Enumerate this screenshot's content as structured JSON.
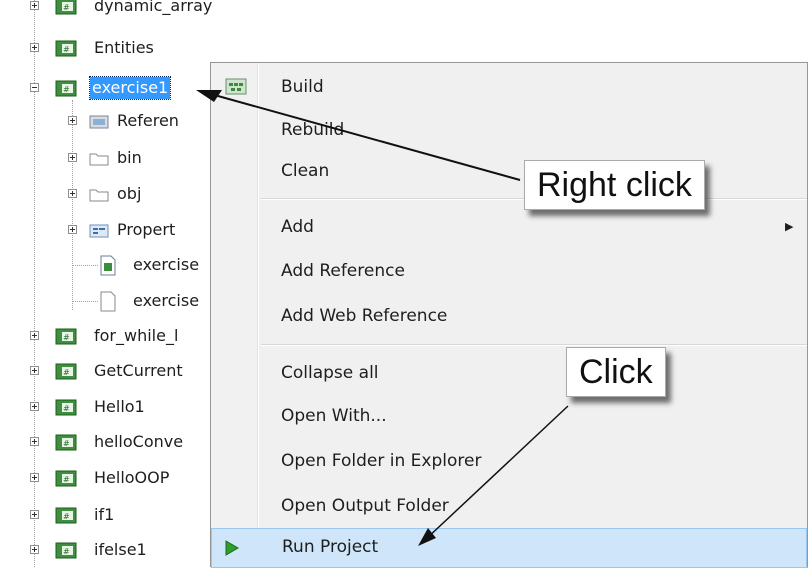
{
  "tree": {
    "items": [
      {
        "label": "dynamic_array",
        "icon": "csharp-project-icon",
        "expander": "plus"
      },
      {
        "label": "Entities",
        "icon": "csharp-project-icon",
        "expander": "plus"
      },
      {
        "label": "exercise1",
        "icon": "csharp-project-icon",
        "expander": "minus",
        "selected": true
      },
      {
        "label": "Referen",
        "icon": "references-icon",
        "expander": "plus"
      },
      {
        "label": "bin",
        "icon": "folder-icon",
        "expander": "plus"
      },
      {
        "label": "obj",
        "icon": "folder-icon",
        "expander": "plus"
      },
      {
        "label": "Propert",
        "icon": "properties-folder-icon",
        "expander": "plus"
      },
      {
        "label": "exercise",
        "icon": "config-file-icon"
      },
      {
        "label": "exercise",
        "icon": "file-icon"
      },
      {
        "label": "for_while_l",
        "icon": "csharp-project-icon",
        "expander": "plus"
      },
      {
        "label": "GetCurrent",
        "icon": "csharp-project-icon",
        "expander": "plus"
      },
      {
        "label": "Hello1",
        "icon": "csharp-project-icon",
        "expander": "plus"
      },
      {
        "label": "helloConve",
        "icon": "csharp-project-icon",
        "expander": "plus"
      },
      {
        "label": "HelloOOP",
        "icon": "csharp-project-icon",
        "expander": "plus"
      },
      {
        "label": "if1",
        "icon": "csharp-project-icon",
        "expander": "plus"
      },
      {
        "label": "ifelse1",
        "icon": "csharp-project-icon",
        "expander": "plus"
      }
    ]
  },
  "context_menu": {
    "items": [
      {
        "label": "Build",
        "icon": "build-icon"
      },
      {
        "label": "Rebuild"
      },
      {
        "label": "Clean"
      },
      {
        "label": "Add",
        "submenu": true
      },
      {
        "label": "Add Reference"
      },
      {
        "label": "Add Web Reference"
      },
      {
        "label": "Collapse all"
      },
      {
        "label": "Open With..."
      },
      {
        "label": "Open Folder in Explorer"
      },
      {
        "label": "Open Output Folder"
      },
      {
        "label": "Run Project",
        "icon": "run-icon",
        "highlighted": true
      }
    ]
  },
  "callouts": {
    "right_click": "Right click",
    "click": "Click"
  },
  "colors": {
    "selection": "#3399ff",
    "menu_highlight": "#cfe6fa",
    "run_icon": "#2e9e2e"
  }
}
